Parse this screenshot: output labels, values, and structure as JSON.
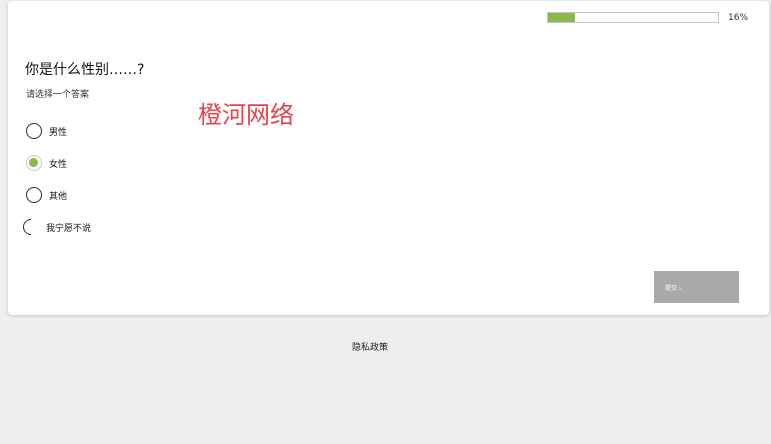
{
  "progress": {
    "percent_label": "16%",
    "fraction": 0.16
  },
  "question": {
    "title": "你是什么性别……?",
    "hint": "请选择一个答案"
  },
  "watermark": "橙河网络",
  "options": [
    {
      "label": "男性",
      "selected": false
    },
    {
      "label": "女性",
      "selected": true
    },
    {
      "label": "其他",
      "selected": false
    },
    {
      "label": "我宁愿不说",
      "selected": false
    }
  ],
  "submit": {
    "label": "提交 ›"
  },
  "footer": {
    "privacy_label": "隐私政策"
  },
  "colors": {
    "accent": "#8cb74b",
    "background": "#eeeeee",
    "button": "#a9a9a9",
    "watermark": "#e8434a"
  }
}
